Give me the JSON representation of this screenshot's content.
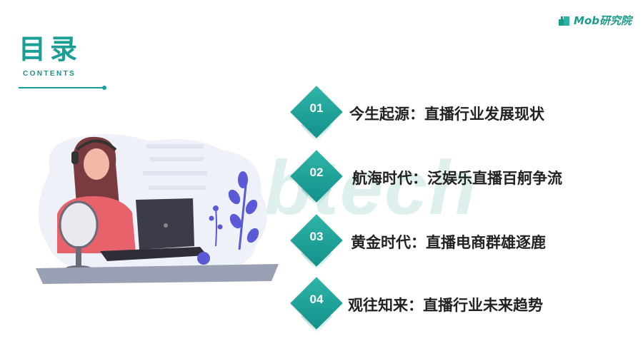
{
  "brand": {
    "logo_text": "Mob研究院"
  },
  "header": {
    "title": "目录",
    "subtitle": "CONTENTS"
  },
  "watermark": "Mobtech",
  "toc": [
    {
      "number": "01",
      "text": "今生起源：直播行业发展现状"
    },
    {
      "number": "02",
      "text": "航海时代：泛娱乐直播百舸争流"
    },
    {
      "number": "03",
      "text": "黄金时代：直播电商群雄逐鹿"
    },
    {
      "number": "04",
      "text": "观往知来：直播行业未来趋势"
    }
  ],
  "colors": {
    "accent": "#1b9e95",
    "text": "#222222",
    "watermark": "#d4ece8"
  }
}
